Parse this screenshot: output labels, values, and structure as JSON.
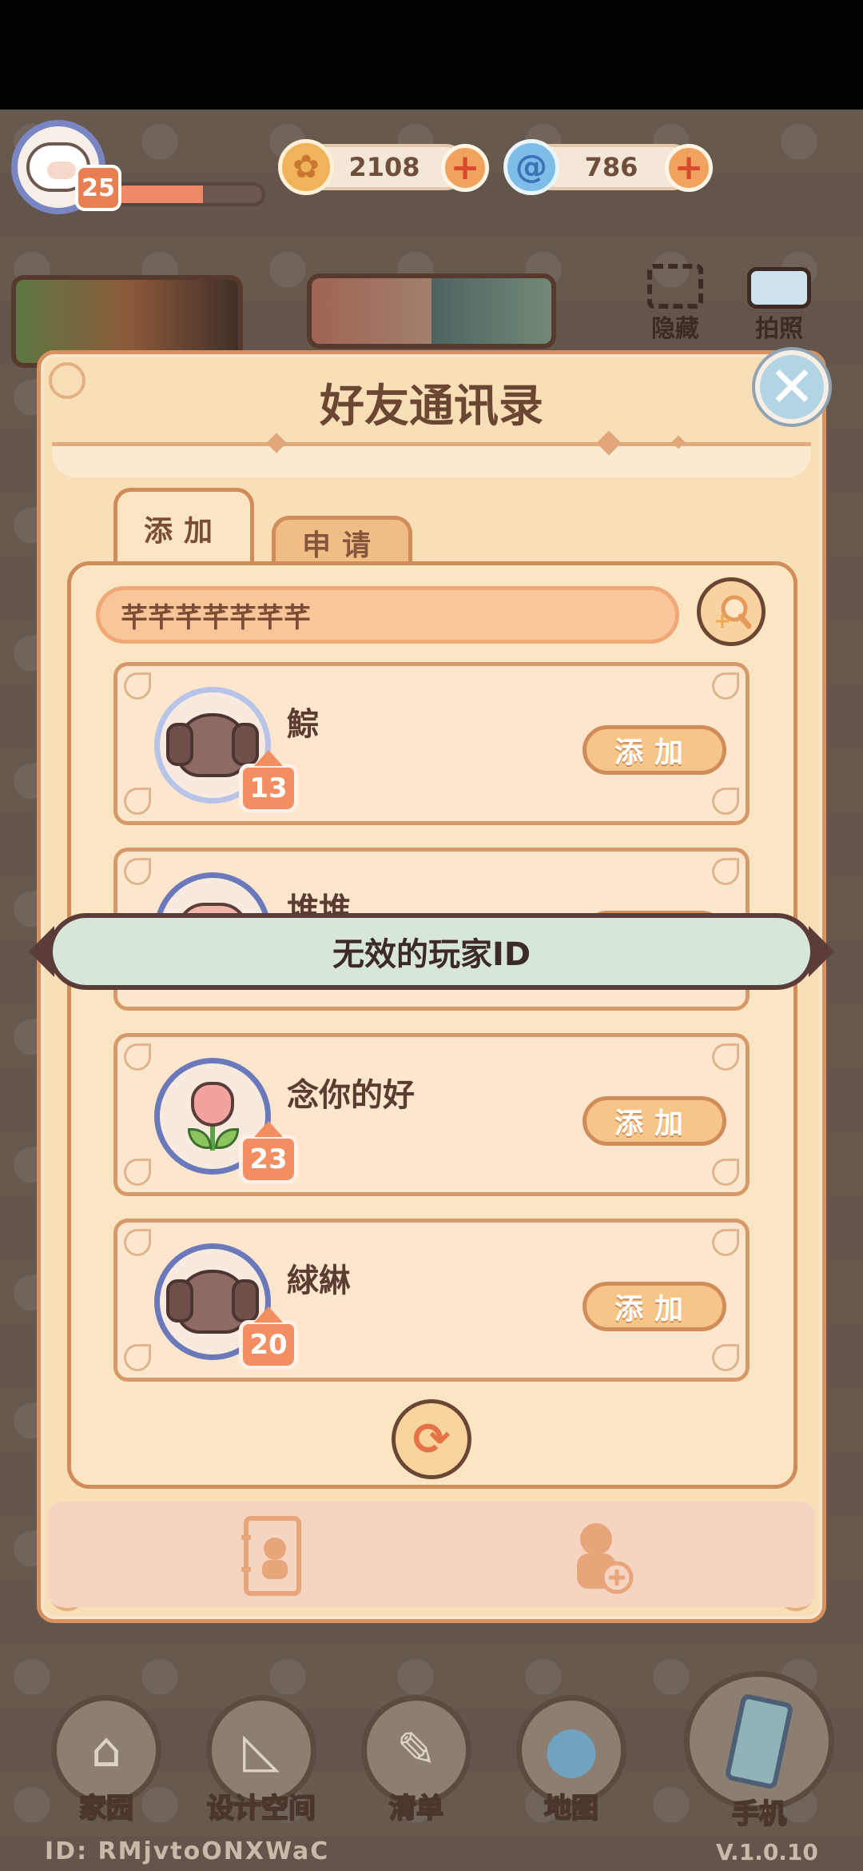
{
  "hud": {
    "level": "25",
    "xp_fraction": 0.6,
    "coins": "2108",
    "gems": "786",
    "hide_label": "隐藏",
    "photo_label": "拍照"
  },
  "dialog": {
    "title": "好友通讯录",
    "tabs": [
      {
        "label": "添加",
        "active": true
      },
      {
        "label": "申请",
        "active": false
      }
    ],
    "search_value": "芊芊芊芊芊芊芊",
    "add_label": "添加",
    "results": [
      {
        "name": "鯮",
        "level": "13",
        "avatar": "dog"
      },
      {
        "name": "堆堆",
        "level": "",
        "avatar": "rabbit"
      },
      {
        "name": "念你的好",
        "level": "23",
        "avatar": "tulip"
      },
      {
        "name": "絿綝",
        "level": "20",
        "avatar": "dog"
      }
    ]
  },
  "toast": "无效的玩家ID",
  "nav": [
    {
      "label": "家园",
      "icon": "house-icon"
    },
    {
      "label": "设计空间",
      "icon": "ruler-icon"
    },
    {
      "label": "清单",
      "icon": "list-icon"
    },
    {
      "label": "地图",
      "icon": "map-pin-icon"
    },
    {
      "label": "手机",
      "icon": "phone-icon"
    }
  ],
  "footer_text": {
    "player_id": "ID: RMjvtoONXWaC",
    "version": "V.1.0.10"
  },
  "colors": {
    "panel": "#fbe6c4",
    "border": "#d08d59",
    "badge": "#f28e61",
    "toast_bg": "#d7e6d9",
    "close": "#b3d5e3"
  }
}
